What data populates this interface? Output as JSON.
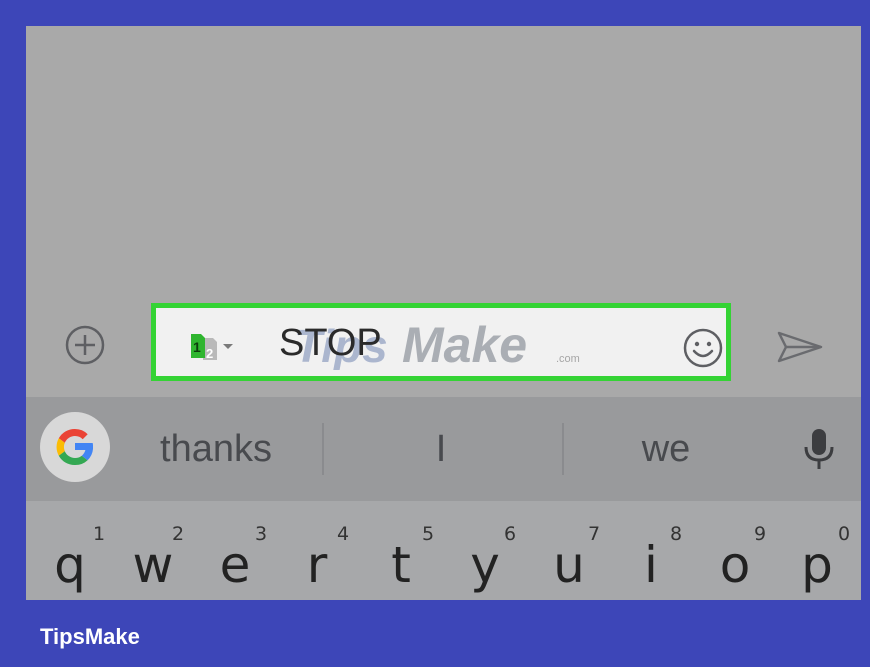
{
  "message": {
    "text": "STOP",
    "sim_badge": "1",
    "sim_badge_2": "2"
  },
  "watermark": {
    "text_1": "Tips",
    "text_2": "Make",
    "text_3": ".com"
  },
  "suggestions": [
    "thanks",
    "I",
    "we"
  ],
  "keyboard": {
    "row": [
      {
        "char": "q",
        "hint": "1"
      },
      {
        "char": "w",
        "hint": "2"
      },
      {
        "char": "e",
        "hint": "3"
      },
      {
        "char": "r",
        "hint": "4"
      },
      {
        "char": "t",
        "hint": "5"
      },
      {
        "char": "y",
        "hint": "6"
      },
      {
        "char": "u",
        "hint": "7"
      },
      {
        "char": "i",
        "hint": "8"
      },
      {
        "char": "o",
        "hint": "9"
      },
      {
        "char": "p",
        "hint": "0"
      }
    ]
  },
  "footer": {
    "brand": "TipsMake"
  },
  "icons": {
    "attach": "plus-circle-icon",
    "sim": "dual-sim-icon",
    "emoji": "smiley-icon",
    "send": "send-icon",
    "google": "google-g-icon",
    "mic": "microphone-icon"
  },
  "colors": {
    "frame": "#3d46b8",
    "highlight": "#34d334",
    "screen_bg": "#a9a9a9",
    "sim_green": "#2fb52f"
  }
}
